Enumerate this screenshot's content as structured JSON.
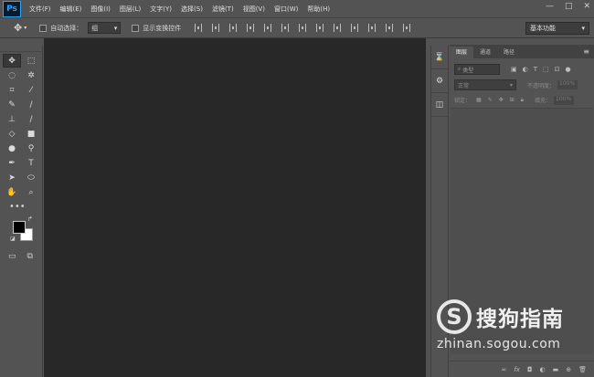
{
  "app": {
    "logo": "Ps"
  },
  "menu": [
    "文件(F)",
    "编辑(E)",
    "图像(I)",
    "图层(L)",
    "文字(Y)",
    "选择(S)",
    "滤镜(T)",
    "视图(V)",
    "窗口(W)",
    "帮助(H)"
  ],
  "window_controls": {
    "minimize": "—",
    "maximize": "□",
    "close": "✕"
  },
  "options": {
    "auto_select_label": "自动选择：",
    "auto_select_value": "组",
    "show_transform_label": "显示变换控件",
    "workspace": "基本功能"
  },
  "tools": {
    "icons": [
      "move-icon",
      "marquee-icon",
      "lasso-icon",
      "magic-wand-icon",
      "crop-icon",
      "eyedropper-icon",
      "healing-brush-icon",
      "brush-icon",
      "clone-stamp-icon",
      "history-brush-icon",
      "eraser-icon",
      "gradient-icon",
      "blur-icon",
      "dodge-icon",
      "pen-icon",
      "type-icon",
      "path-selection-icon",
      "ellipse-icon",
      "hand-icon",
      "zoom-icon"
    ],
    "glyphs": [
      "✥",
      "⬚",
      "◌",
      "✲",
      "⌗",
      "⁄",
      "✎",
      "∕",
      "⊥",
      "∕",
      "◇",
      "■",
      "●",
      "⚲",
      "✒",
      "T",
      "➤",
      "⬭",
      "✋",
      "⌕"
    ],
    "more": "•••",
    "foreground_color": "#000000",
    "background_color": "#ffffff"
  },
  "panel": {
    "tabs": [
      "图层",
      "通道",
      "路径"
    ],
    "filter_placeholder": "类型",
    "blend_mode": "正常",
    "opacity_label": "不透明度：",
    "opacity_value": "100%",
    "lock_label": "锁定：",
    "fill_label": "填充：",
    "fill_value": "100%"
  },
  "watermark": {
    "letter": "S",
    "name": "搜狗指南",
    "url": "zhinan.sogou.com"
  },
  "colors": {
    "canvas": "#282828",
    "chrome": "#535353",
    "ps_accent": "#2fa3f5"
  }
}
